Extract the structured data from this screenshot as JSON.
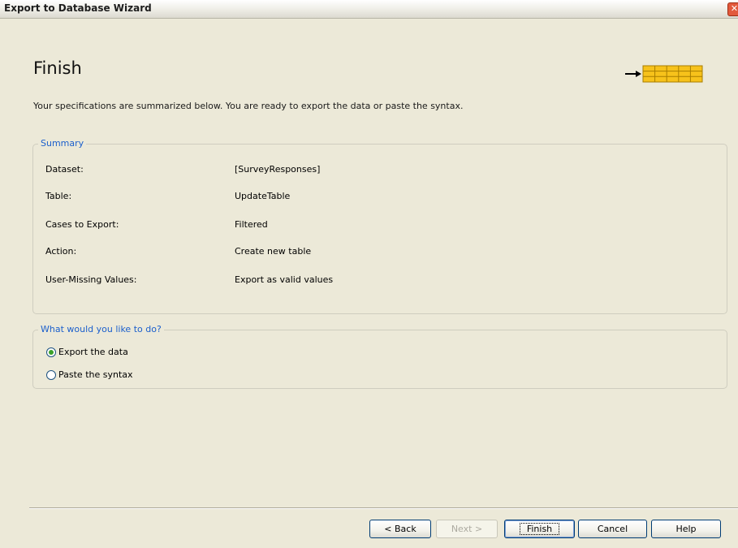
{
  "window": {
    "title": "Export to Database Wizard",
    "close_glyph": "✕"
  },
  "page": {
    "title": "Finish",
    "intro": "Your specifications are summarized below. You are ready to export the data or paste the syntax.",
    "header_icon": "arrow-into-table-icon"
  },
  "summary": {
    "legend": "Summary",
    "rows": [
      {
        "label": "Dataset:",
        "value": "[SurveyResponses]"
      },
      {
        "label": "Table:",
        "value": "UpdateTable"
      },
      {
        "label": "Cases to Export:",
        "value": "Filtered"
      },
      {
        "label": "Action:",
        "value": "Create new table"
      },
      {
        "label": "User-Missing Values:",
        "value": "Export as valid values"
      }
    ]
  },
  "options": {
    "legend": "What would you like to do?",
    "choices": [
      {
        "label": "Export the data",
        "checked": true
      },
      {
        "label": "Paste the syntax",
        "checked": false
      }
    ]
  },
  "buttons": {
    "back": "< Back",
    "next": "Next >",
    "finish": "Finish",
    "cancel": "Cancel",
    "help": "Help"
  },
  "colors": {
    "accent": "#1b5fcc",
    "window_bg": "#ece9d8",
    "table_icon": "#f7c21b"
  }
}
